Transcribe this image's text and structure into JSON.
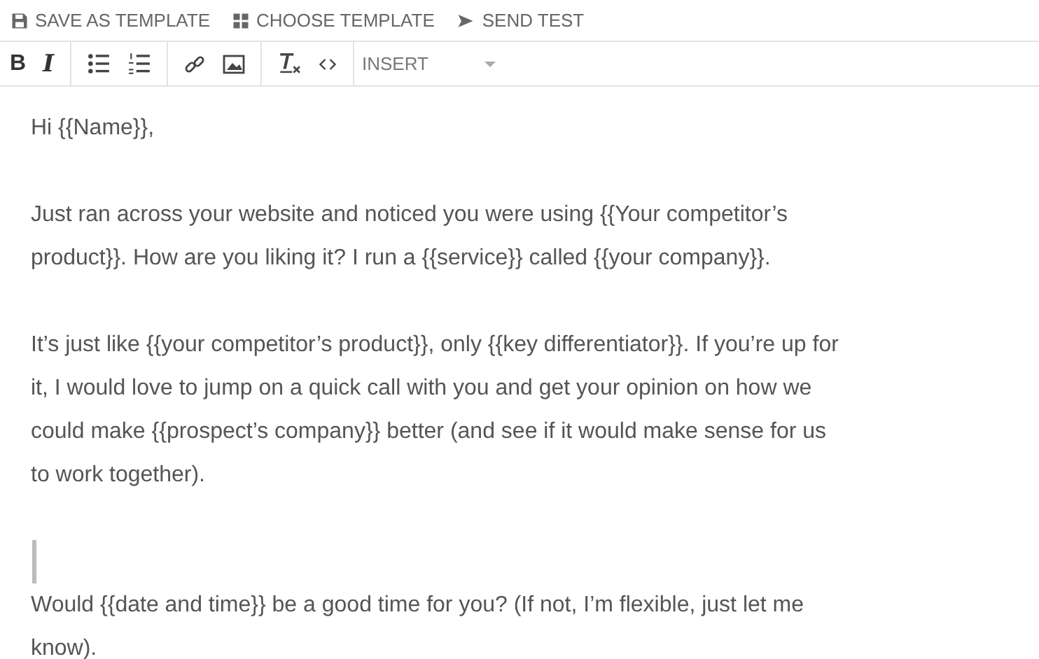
{
  "actions": [
    {
      "kind": "save",
      "label": "SAVE AS TEMPLATE"
    },
    {
      "kind": "choose",
      "label": "CHOOSE TEMPLATE"
    },
    {
      "kind": "send",
      "label": "SEND TEST"
    }
  ],
  "format_toolbar": {
    "groups": [
      [
        {
          "kind": "bold",
          "label": "B"
        },
        {
          "kind": "italic",
          "label": "I"
        }
      ],
      [
        {
          "kind": "bullets"
        },
        {
          "kind": "numbers"
        }
      ],
      [
        {
          "kind": "link"
        },
        {
          "kind": "image"
        }
      ],
      [
        {
          "kind": "clear"
        },
        {
          "kind": "code"
        }
      ]
    ],
    "insert": {
      "label": "INSERT"
    }
  },
  "body": [
    {
      "kind": "text",
      "lines": [
        "Hi {{Name}},"
      ]
    },
    {
      "kind": "text",
      "lines": [
        "Just ran across your website and noticed you were using {{Your competitor’s",
        "product}}. How are you liking it? I run a {{service}} called {{your company}}."
      ]
    },
    {
      "kind": "text",
      "lines": [
        "It’s just like {{your competitor’s product}}, only {{key differentiator}}. If you’re up for",
        "it, I would love to jump on a quick call with you and get your opinion on how we",
        "could make {{prospect’s company}} better (and see if it would make sense for us",
        "to work together)."
      ]
    },
    {
      "kind": "cursor"
    },
    {
      "kind": "text",
      "lines": [
        "Would {{date and time}} be a good time for you? (If not, I’m flexible, just let me",
        "know)."
      ]
    }
  ]
}
